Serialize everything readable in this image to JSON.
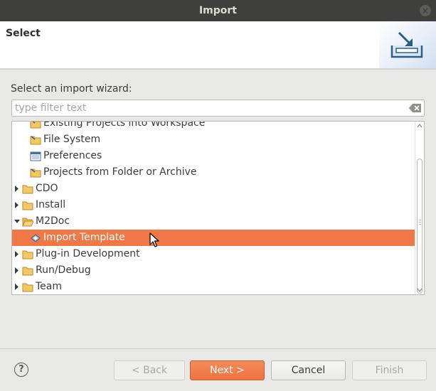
{
  "window": {
    "title": "Import",
    "close_icon": "close-icon"
  },
  "header": {
    "title": "Select",
    "banner_icon": "import-wizard-icon"
  },
  "prompt": "Select an import wizard:",
  "filter": {
    "placeholder": "type filter text",
    "value": ""
  },
  "tree": {
    "items": [
      {
        "label": "Existing Projects into Workspace",
        "icon": "folder-import-icon",
        "level": 1,
        "expander": "none"
      },
      {
        "label": "File System",
        "icon": "folder-import-icon",
        "level": 1,
        "expander": "none"
      },
      {
        "label": "Preferences",
        "icon": "preferences-icon",
        "level": 1,
        "expander": "none"
      },
      {
        "label": "Projects from Folder or Archive",
        "icon": "folder-import-icon",
        "level": 1,
        "expander": "none"
      },
      {
        "label": "CDO",
        "icon": "folder-icon",
        "level": 0,
        "expander": "collapsed"
      },
      {
        "label": "Install",
        "icon": "folder-icon",
        "level": 0,
        "expander": "collapsed"
      },
      {
        "label": "M2Doc",
        "icon": "folder-open-icon",
        "level": 0,
        "expander": "expanded"
      },
      {
        "label": "Import Template",
        "icon": "template-icon",
        "level": 1,
        "expander": "none",
        "selected": true
      },
      {
        "label": "Plug-in Development",
        "icon": "folder-icon",
        "level": 0,
        "expander": "collapsed"
      },
      {
        "label": "Run/Debug",
        "icon": "folder-icon",
        "level": 0,
        "expander": "collapsed"
      },
      {
        "label": "Team",
        "icon": "folder-icon",
        "level": 0,
        "expander": "collapsed"
      }
    ]
  },
  "buttons": {
    "help": "?",
    "back": "< Back",
    "next": "Next >",
    "cancel": "Cancel",
    "finish": "Finish"
  },
  "colors": {
    "selection": "#f07746",
    "titlebar": "#3f3f3e",
    "accent": "#ee7440"
  }
}
